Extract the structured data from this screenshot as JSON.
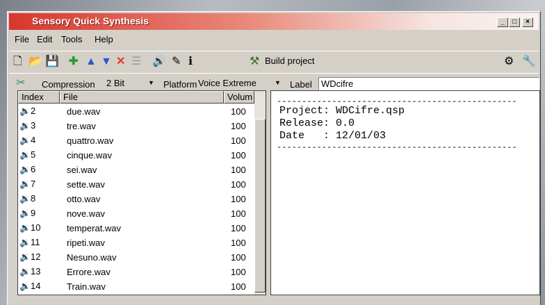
{
  "window": {
    "title": "Sensory Quick Synthesis"
  },
  "menu": [
    "File",
    "Edit",
    "Tools",
    "Help"
  ],
  "toolbar": {
    "build_label": "Build project"
  },
  "options": {
    "compression_label": "Compression",
    "compression_value": "2 Bit",
    "platform_label": "Platform",
    "platform_value": "Voice Extreme",
    "label_label": "Label",
    "label_value": "WDcifre"
  },
  "list": {
    "columns": [
      "Index",
      "File",
      "Volum"
    ],
    "rows": [
      {
        "index": "2",
        "file": "due.wav",
        "volume": "100"
      },
      {
        "index": "3",
        "file": "tre.wav",
        "volume": "100"
      },
      {
        "index": "4",
        "file": "quattro.wav",
        "volume": "100"
      },
      {
        "index": "5",
        "file": "cinque.wav",
        "volume": "100"
      },
      {
        "index": "6",
        "file": "sei.wav",
        "volume": "100"
      },
      {
        "index": "7",
        "file": "sette.wav",
        "volume": "100"
      },
      {
        "index": "8",
        "file": "otto.wav",
        "volume": "100"
      },
      {
        "index": "9",
        "file": "nove.wav",
        "volume": "100"
      },
      {
        "index": "10",
        "file": "temperat.wav",
        "volume": "100"
      },
      {
        "index": "11",
        "file": "ripeti.wav",
        "volume": "100"
      },
      {
        "index": "12",
        "file": "Nesuno.wav",
        "volume": "100"
      },
      {
        "index": "13",
        "file": "Errore.wav",
        "volume": "100"
      },
      {
        "index": "14",
        "file": "Train.wav",
        "volume": "100"
      }
    ]
  },
  "info": {
    "separator": "------------------------------------------------",
    "project": "Project: WDCifre.qsp",
    "release": "Release: 0.0",
    "date": "Date   : 12/01/03"
  }
}
